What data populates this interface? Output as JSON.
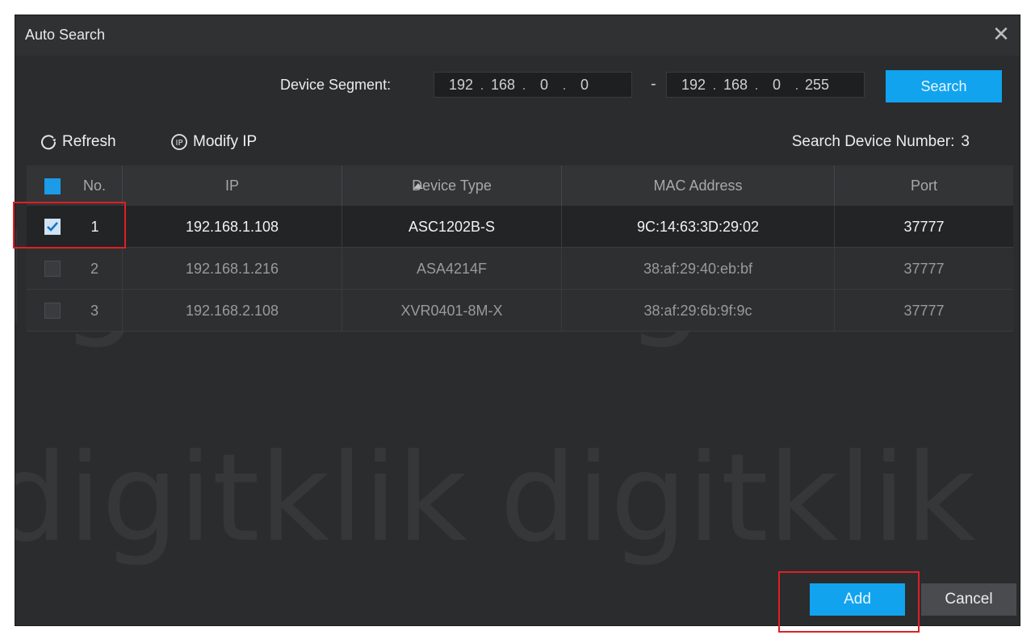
{
  "dialog": {
    "title": "Auto Search"
  },
  "segment": {
    "label": "Device Segment:",
    "start": [
      "192",
      "168",
      "0",
      "0"
    ],
    "end": [
      "192",
      "168",
      "0",
      "255"
    ],
    "separator": "-",
    "search_label": "Search"
  },
  "toolbar": {
    "refresh_label": "Refresh",
    "modify_ip_label": "Modify IP",
    "count_label": "Search Device Number:",
    "count_value": "3"
  },
  "table": {
    "headers": {
      "no": "No.",
      "ip": "IP",
      "device_type": "Device Type",
      "mac": "MAC Address",
      "port": "Port"
    },
    "rows": [
      {
        "no": "1",
        "ip": "192.168.1.108",
        "device_type": "ASC1202B-S",
        "mac": "9C:14:63:3D:29:02",
        "port": "37777",
        "checked": true
      },
      {
        "no": "2",
        "ip": "192.168.1.216",
        "device_type": "ASA4214F",
        "mac": "38:af:29:40:eb:bf",
        "port": "37777",
        "checked": false
      },
      {
        "no": "3",
        "ip": "192.168.2.108",
        "device_type": "XVR0401-8M-X",
        "mac": "38:af:29:6b:9f:9c",
        "port": "37777",
        "checked": false
      }
    ]
  },
  "footer": {
    "add_label": "Add",
    "cancel_label": "Cancel"
  },
  "watermark": {
    "text": "digitklik"
  },
  "colors": {
    "accent": "#11a3ee",
    "highlight": "#e01f25",
    "background": "#2b2c2e"
  }
}
